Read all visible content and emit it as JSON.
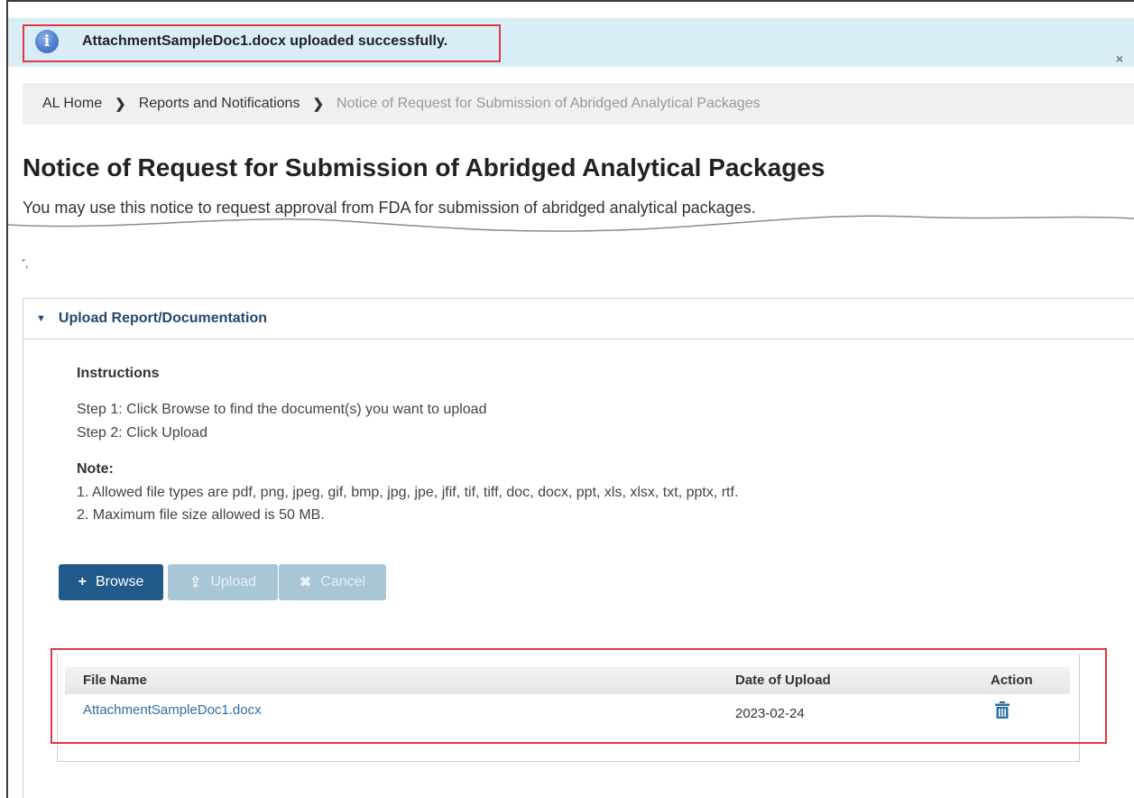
{
  "alert": {
    "message": "AttachmentSampleDoc1.docx uploaded successfully.",
    "close": "×",
    "icon": "info-icon",
    "info_glyph": "i"
  },
  "breadcrumb": {
    "items": [
      "AL Home",
      "Reports and Notifications",
      "Notice of Request for Submission of Abridged Analytical Packages"
    ],
    "separator": "❯"
  },
  "page": {
    "title": "Notice of Request for Submission of Abridged Analytical Packages",
    "subtitle": "You may use this notice to request approval from FDA for submission of abridged analytical packages.",
    "tick": "ˇ,"
  },
  "panel": {
    "caret": "▼",
    "title": "Upload Report/Documentation",
    "instructions_title": "Instructions",
    "steps": [
      "Step 1: Click Browse to find the document(s) you want to upload",
      "Step 2: Click Upload"
    ],
    "note_title": "Note:",
    "notes": [
      "1. Allowed file types are pdf, png, jpeg, gif, bmp, jpg, jpe, jfif, tif, tiff, doc, docx, ppt, xls, xlsx, txt, pptx, rtf.",
      "2. Maximum file size allowed is 50 MB."
    ]
  },
  "buttons": {
    "browse": "Browse",
    "browse_icon": "+",
    "upload": "Upload",
    "upload_icon": "⇪",
    "cancel": "Cancel",
    "cancel_icon": "✖"
  },
  "table": {
    "headers": [
      "File Name",
      "Date of Upload",
      "Action"
    ],
    "rows": [
      {
        "file_name": "AttachmentSampleDoc1.docx",
        "date": "2023-02-24",
        "action_icon": "trash-icon"
      }
    ]
  },
  "colors": {
    "alert_bg": "#d9edf7",
    "primary_button": "#215a8a",
    "disabled_button": "#a9c6d6",
    "highlight_border": "#e0393e",
    "link": "#2b6ea3"
  }
}
